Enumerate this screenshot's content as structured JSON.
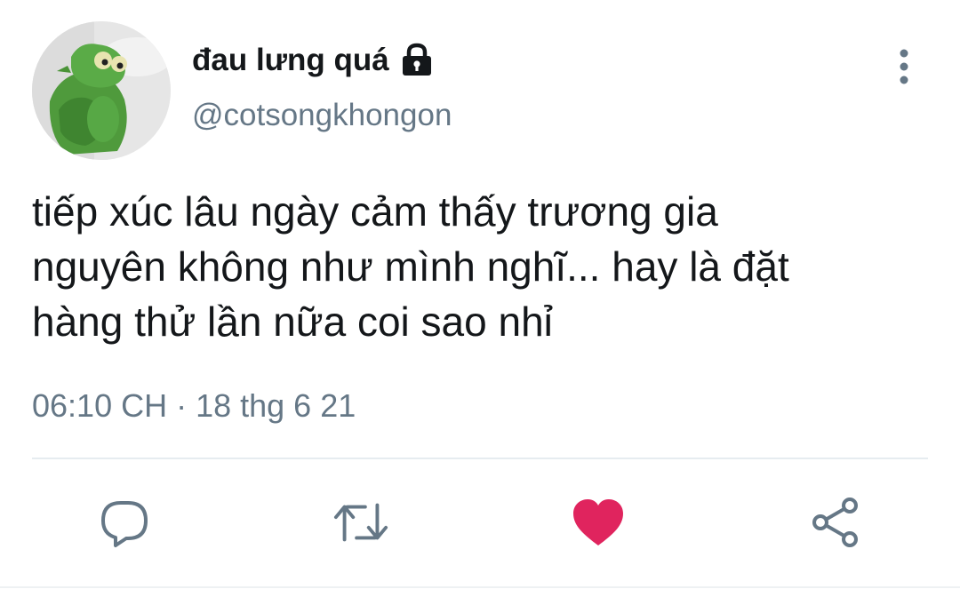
{
  "user": {
    "display_name": "đau lưng quá",
    "handle": "@cotsongkhongon",
    "protected": true,
    "avatar_icon": "kermit-avatar",
    "lock_icon": "lock-icon"
  },
  "tweet": {
    "text": "tiếp xúc lâu ngày cảm thấy trương gia\nnguyên không như mình nghĩ... hay là đặt\nhàng thử lần nữa coi sao nhỉ",
    "timestamp": "06:10 CH · 18 thg 6 21"
  },
  "actions": {
    "reply_icon": "reply-icon",
    "retweet_icon": "retweet-icon",
    "like_icon": "heart-icon",
    "liked": true,
    "share_icon": "share-icon",
    "more_icon": "more-vertical-icon"
  },
  "colors": {
    "text_primary": "#14171a",
    "text_secondary": "#657786",
    "like_active": "#e0245e",
    "icon_default": "#657786",
    "divider": "#e6ecf0"
  }
}
